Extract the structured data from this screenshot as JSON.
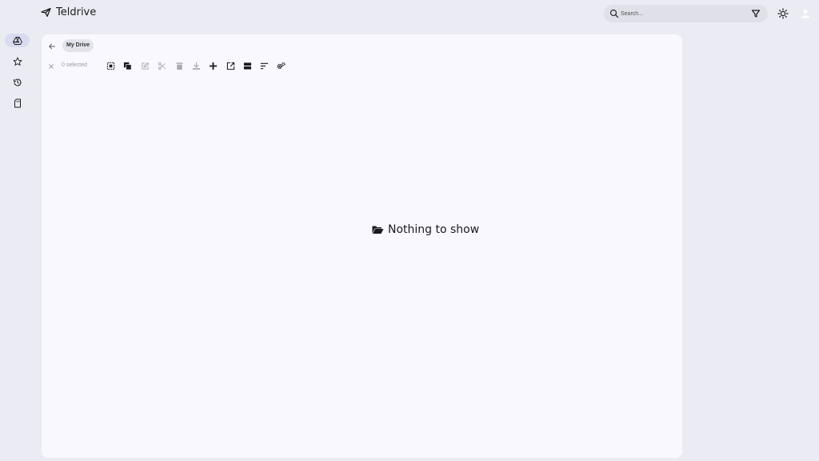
{
  "app": {
    "name": "Teldrive"
  },
  "search": {
    "placeholder": "Search..."
  },
  "sidebar": {
    "items": [
      {
        "name": "My Drive",
        "icon": "drive-icon",
        "active": true
      },
      {
        "name": "Starred",
        "icon": "star-icon"
      },
      {
        "name": "Recent",
        "icon": "history-icon"
      },
      {
        "name": "Storage",
        "icon": "sd-card-icon"
      }
    ]
  },
  "breadcrumb": {
    "items": [
      "My Drive"
    ]
  },
  "toolbar": {
    "selected_count": "0 selected",
    "actions": [
      {
        "icon": "select-all-icon",
        "enabled": true
      },
      {
        "icon": "copy-icon",
        "enabled": true
      },
      {
        "icon": "rename-icon",
        "enabled": false
      },
      {
        "icon": "cut-icon",
        "enabled": false
      },
      {
        "icon": "delete-icon",
        "enabled": false
      },
      {
        "icon": "download-icon",
        "enabled": false
      },
      {
        "icon": "add-icon",
        "enabled": true
      },
      {
        "icon": "open-external-icon",
        "enabled": true
      },
      {
        "icon": "view-mode-icon",
        "enabled": true
      },
      {
        "icon": "sort-icon",
        "enabled": true
      },
      {
        "icon": "settings-icon",
        "enabled": true
      }
    ]
  },
  "empty_state": {
    "message": "Nothing to show",
    "icon": "folder-open-icon"
  },
  "colors": {
    "background": "#ebecf3",
    "panel": "#f8f8fe",
    "active_nav": "#d9dcf0",
    "disabled": "#a8a8b0"
  }
}
